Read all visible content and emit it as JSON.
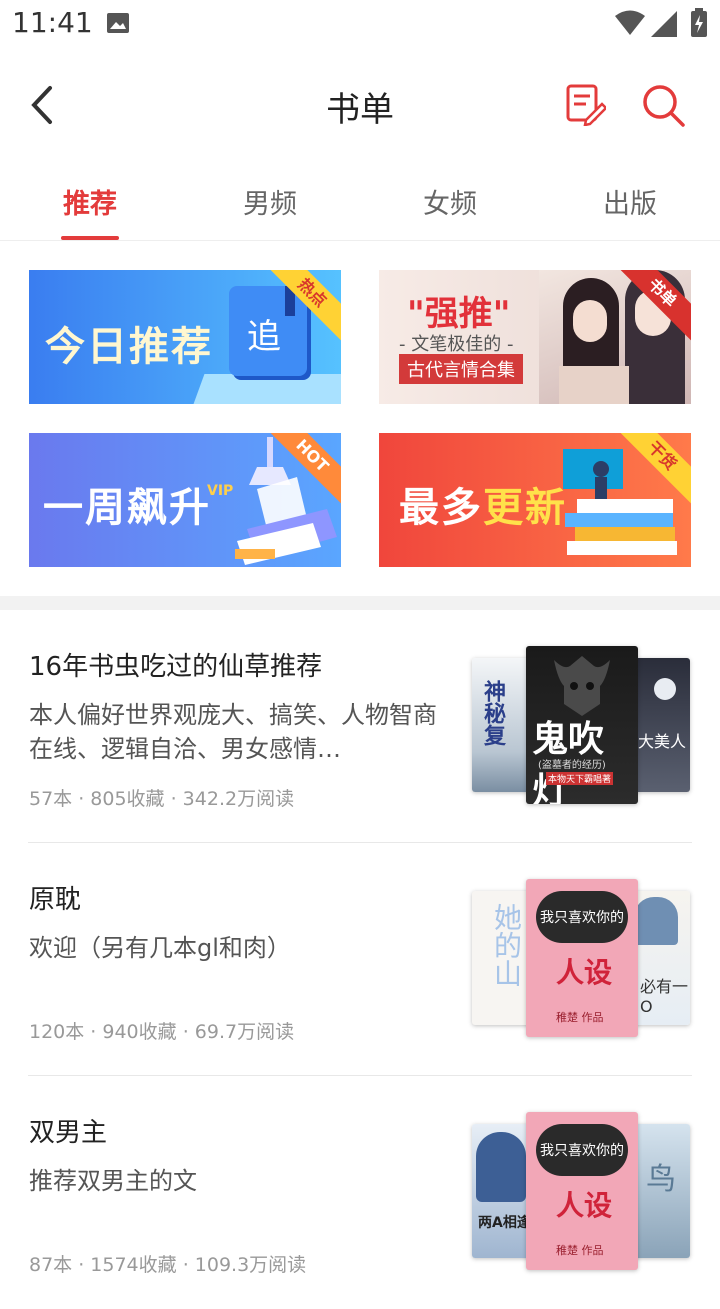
{
  "status_bar": {
    "time": "11:41",
    "icons": [
      "image-icon",
      "wifi-icon",
      "signal-icon",
      "battery-icon"
    ]
  },
  "header": {
    "title": "书单",
    "back_icon": "chevron-left-icon",
    "edit_icon": "edit-note-icon",
    "search_icon": "search-icon",
    "accent_color": "#e33b3b"
  },
  "tabs": [
    {
      "label": "推荐",
      "active": true
    },
    {
      "label": "男频",
      "active": false
    },
    {
      "label": "女频",
      "active": false
    },
    {
      "label": "出版",
      "active": false
    }
  ],
  "banners": [
    {
      "title": "今日推荐",
      "corner": "热点",
      "bg": "#3e8bf0"
    },
    {
      "title": "\"强推\"",
      "subtitle": "- 文笔极佳的 -",
      "caption": "古代言情合集",
      "corner": "书单",
      "bg": "#f6e7e3"
    },
    {
      "title": "一周飙升",
      "badge": "VIP",
      "corner": "HOT",
      "bg": "#6b6df0"
    },
    {
      "title": "最多更新",
      "corner": "干货",
      "bg": "#f2493d"
    }
  ],
  "booklists": [
    {
      "name": "16年书虫吃过的仙草推荐",
      "desc": "本人偏好世界观庞大、搞笑、人物智商在线、逻辑自洽、男女感情…",
      "meta": "57本 · 805收藏 · 342.2万阅读",
      "covers": {
        "left_text": "神秘复",
        "front_title": "鬼吹灯",
        "front_sub": "(盗墓者的经历)",
        "front_author": "本物天下霸唱著",
        "right_text": "大美人"
      }
    },
    {
      "name": "原耽",
      "desc": "欢迎（另有几本gl和肉）",
      "meta": "120本 · 940收藏 · 69.7万阅读",
      "covers": {
        "left_text": "她的山",
        "front_top": "我只喜欢你的",
        "front_title": "人设",
        "front_author": "稚楚 作品",
        "right_text": "必有一O"
      }
    },
    {
      "name": "双男主",
      "desc": "推荐双男主的文",
      "meta": "87本 · 1574收藏 · 109.3万阅读",
      "covers": {
        "left_text": "两A相逢",
        "front_top": "我只喜欢你的",
        "front_title": "人设",
        "front_author": "稚楚 作品",
        "right_text": "鸟"
      }
    }
  ]
}
